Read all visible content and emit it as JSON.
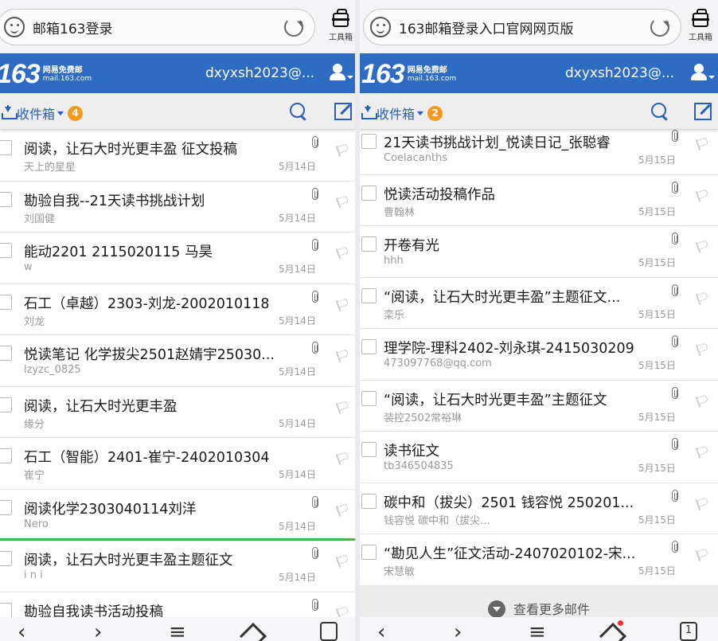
{
  "left": {
    "url": "邮箱163登录",
    "tools_label": "工具箱",
    "logo_num": "163",
    "logo_line1": "网易免费邮",
    "logo_line2": "mail.163.com",
    "account": "dxyxsh2023@...",
    "folder": "收件箱",
    "unread": "4",
    "mails": [
      {
        "subject": "阅读，让石大时光更丰盈 征文投稿",
        "sender": "天上的星星",
        "date": "5月14日",
        "attach": true
      },
      {
        "subject": "勘验自我--21天读书挑战计划",
        "sender": "刘国健",
        "date": "5月14日",
        "attach": true
      },
      {
        "subject": "能动2201 2115020115 马昊",
        "sender": "w",
        "date": "5月14日",
        "attach": true
      },
      {
        "subject": "石工（卓越）2303-刘龙-2002010118",
        "sender": "刘龙",
        "date": "5月14日",
        "attach": true
      },
      {
        "subject": "悦读笔记 化学拔尖2501赵婧宇25030...",
        "sender": "lzyzc_0825",
        "date": "5月14日",
        "attach": true
      },
      {
        "subject": "阅读，让石大时光更丰盈",
        "sender": "缘分",
        "date": "5月14日",
        "attach": false
      },
      {
        "subject": "石工（智能）2401-崔宁-2402010304",
        "sender": "崔宁",
        "date": "5月14日",
        "attach": false
      },
      {
        "subject": "阅读化学2303040114刘洋",
        "sender": "Nero",
        "date": "5月14日",
        "attach": true
      },
      {
        "subject": "阅读，让石大时光更丰盈主题征文",
        "sender": "i n i",
        "date": "5月14日",
        "attach": true
      },
      {
        "subject": "勘验自我读书活动投稿",
        "sender": "",
        "date": "",
        "attach": true
      }
    ]
  },
  "right": {
    "url": "163邮箱登录入口官网网页版",
    "tools_label": "工具箱",
    "logo_num": "163",
    "logo_line1": "网易免费邮",
    "logo_line2": "mail.163.com",
    "account": "dxyxsh2023@...",
    "folder": "收件箱",
    "unread": "2",
    "mails": [
      {
        "subject": "21天读书挑战计划_悦读日记_张聪睿",
        "sender": "Coelacanths",
        "date": "5月15日",
        "attach": true
      },
      {
        "subject": "悦读活动投稿作品",
        "sender": "曹翰林",
        "date": "5月15日",
        "attach": true
      },
      {
        "subject": "开卷有光",
        "sender": "hhh",
        "date": "5月15日",
        "attach": true
      },
      {
        "subject": "“阅读，让石大时光更丰盈”主题征文...",
        "sender": "栾乐",
        "date": "5月15日",
        "attach": true
      },
      {
        "subject": "理学院-理科2402-刘永琪-2415030209",
        "sender": "473097768@qq.com",
        "date": "5月15日",
        "attach": true
      },
      {
        "subject": "“阅读，让石大时光更丰盈”主题征文",
        "sender": "装控2502常裕琳",
        "date": "5月15日",
        "attach": true
      },
      {
        "subject": "读书征文",
        "sender": "tb346504835",
        "date": "5月15日",
        "attach": true
      },
      {
        "subject": "碳中和（拔尖）2501 钱容悦 250201...",
        "sender": "钱容悦 碳中和（拔尖...",
        "date": "5月15日",
        "attach": true
      },
      {
        "subject": "“勘见人生”征文活动-2407020102-宋...",
        "sender": "宋慧敏",
        "date": "5月15日",
        "attach": true
      }
    ],
    "more": "查看更多邮件",
    "tabs_count": "1"
  },
  "colors": {
    "brand": "#2e6cc4",
    "link": "#2860b8",
    "badge": "#f59a1c",
    "selected_line": "#4ab34a"
  },
  "icons": [
    "face-icon",
    "reload-icon",
    "toolbox-icon",
    "user-icon",
    "download-icon",
    "search-icon",
    "compose-icon",
    "attachment-icon",
    "flag-icon",
    "back-icon",
    "forward-icon",
    "menu-icon",
    "home-icon",
    "tabs-icon"
  ]
}
